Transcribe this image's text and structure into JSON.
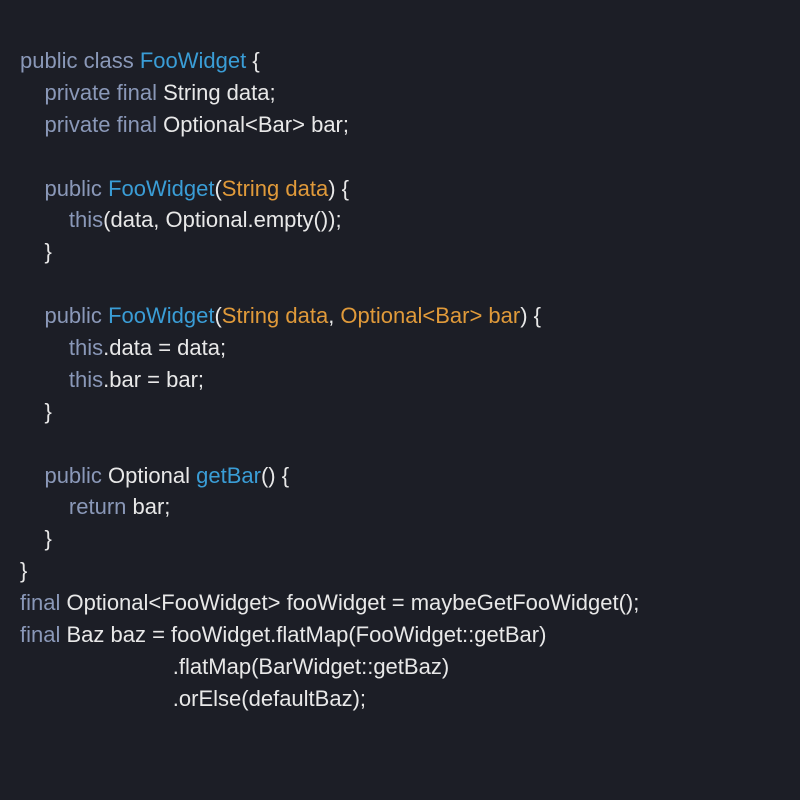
{
  "colors": {
    "background": "#1c1e26",
    "default": "#e8e8e8",
    "keyword": "#8a98b8",
    "type": "#3a9dd6",
    "param": "#e09a3a"
  },
  "code": {
    "tokens": [
      [
        [
          "kw",
          "public"
        ],
        [
          "def",
          " "
        ],
        [
          "kw",
          "class"
        ],
        [
          "def",
          " "
        ],
        [
          "type",
          "FooWidget"
        ],
        [
          "def",
          " {"
        ]
      ],
      [
        [
          "def",
          "    "
        ],
        [
          "kw",
          "private"
        ],
        [
          "def",
          " "
        ],
        [
          "kw",
          "final"
        ],
        [
          "def",
          " String data;"
        ]
      ],
      [
        [
          "def",
          "    "
        ],
        [
          "kw",
          "private"
        ],
        [
          "def",
          " "
        ],
        [
          "kw",
          "final"
        ],
        [
          "def",
          " Optional<Bar> bar;"
        ]
      ],
      [],
      [
        [
          "def",
          "    "
        ],
        [
          "kw",
          "public"
        ],
        [
          "def",
          " "
        ],
        [
          "type",
          "FooWidget"
        ],
        [
          "def",
          "("
        ],
        [
          "prm",
          "String data"
        ],
        [
          "def",
          ") {"
        ]
      ],
      [
        [
          "def",
          "        "
        ],
        [
          "kw",
          "this"
        ],
        [
          "def",
          "(data, Optional.empty());"
        ]
      ],
      [
        [
          "def",
          "    }"
        ]
      ],
      [],
      [
        [
          "def",
          "    "
        ],
        [
          "kw",
          "public"
        ],
        [
          "def",
          " "
        ],
        [
          "type",
          "FooWidget"
        ],
        [
          "def",
          "("
        ],
        [
          "prm",
          "String data"
        ],
        [
          "def",
          ", "
        ],
        [
          "prm",
          "Optional<Bar> bar"
        ],
        [
          "def",
          ") {"
        ]
      ],
      [
        [
          "def",
          "        "
        ],
        [
          "kw",
          "this"
        ],
        [
          "def",
          ".data = data;"
        ]
      ],
      [
        [
          "def",
          "        "
        ],
        [
          "kw",
          "this"
        ],
        [
          "def",
          ".bar = bar;"
        ]
      ],
      [
        [
          "def",
          "    }"
        ]
      ],
      [],
      [
        [
          "def",
          "    "
        ],
        [
          "kw",
          "public"
        ],
        [
          "def",
          " Optional "
        ],
        [
          "type",
          "getBar"
        ],
        [
          "def",
          "() {"
        ]
      ],
      [
        [
          "def",
          "        "
        ],
        [
          "kw",
          "return"
        ],
        [
          "def",
          " bar;"
        ]
      ],
      [
        [
          "def",
          "    }"
        ]
      ],
      [
        [
          "def",
          "}"
        ]
      ],
      [
        [
          "kw",
          "final"
        ],
        [
          "def",
          " Optional<FooWidget> fooWidget = maybeGetFooWidget();"
        ]
      ],
      [
        [
          "kw",
          "final"
        ],
        [
          "def",
          " Baz baz = fooWidget.flatMap(FooWidget::getBar)"
        ]
      ],
      [
        [
          "def",
          "                         .flatMap(BarWidget::getBaz)"
        ]
      ],
      [
        [
          "def",
          "                         .orElse(defaultBaz);"
        ]
      ]
    ]
  }
}
